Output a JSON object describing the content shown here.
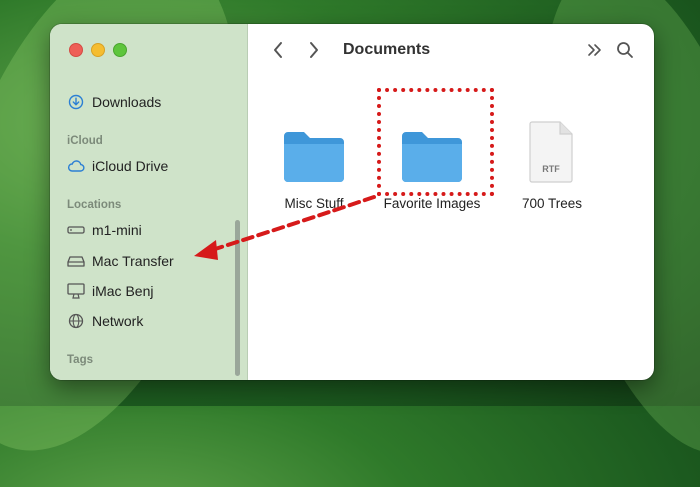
{
  "window": {
    "title": "Documents"
  },
  "sidebar": {
    "favorites": [
      {
        "label": "Downloads",
        "icon": "download-icon"
      }
    ],
    "icloud": {
      "header": "iCloud",
      "items": [
        {
          "label": "iCloud Drive",
          "icon": "cloud-icon"
        }
      ]
    },
    "locations": {
      "header": "Locations",
      "items": [
        {
          "label": "m1-mini",
          "icon": "mac-mini-icon"
        },
        {
          "label": "Mac Transfer",
          "icon": "external-drive-icon"
        },
        {
          "label": "iMac Benj",
          "icon": "imac-icon"
        },
        {
          "label": "Network",
          "icon": "globe-icon"
        }
      ]
    },
    "tags": {
      "header": "Tags"
    }
  },
  "files": [
    {
      "label": "Misc Stuff",
      "type": "folder"
    },
    {
      "label": "Favorite Images",
      "type": "folder"
    },
    {
      "label": "700 Trees",
      "type": "document",
      "badge": "RTF"
    }
  ],
  "colors": {
    "accent_red": "#d61a1a",
    "folder_blue": "#5aaeea",
    "sidebar_bg": "#cfe3c9"
  }
}
